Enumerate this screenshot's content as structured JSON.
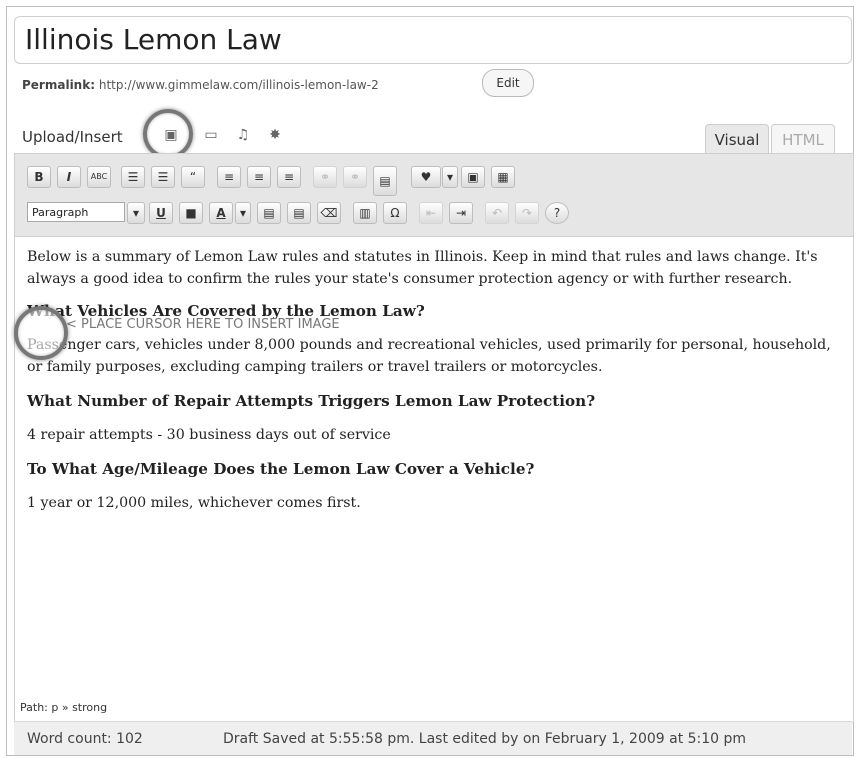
{
  "post": {
    "title": "Illinois Lemon Law",
    "permalink_label": "Permalink:",
    "permalink_url": "http://www.gimmelaw.com/illinois-lemon-law-2",
    "edit_label": "Edit"
  },
  "media": {
    "upload_label": "Upload/Insert",
    "icons": [
      "image-icon",
      "video-icon",
      "audio-icon",
      "media-icon"
    ]
  },
  "tabs": {
    "visual": "Visual",
    "html": "HTML"
  },
  "toolbar": {
    "row1": [
      "B",
      "I",
      "ABC",
      "☰",
      "☰",
      "“",
      "≡",
      "≡",
      "≡",
      "⚭",
      "⚭",
      "▤",
      "♥",
      "▾",
      "▣",
      "▦"
    ],
    "format_value": "Paragraph",
    "row2": [
      "U",
      "■",
      "A",
      "▾",
      "▤",
      "▤",
      "⌫",
      "▥",
      "Ω",
      "⇤",
      "⇥",
      "↶",
      "↷",
      "?"
    ]
  },
  "content": {
    "intro": "Below is a summary of Lemon Law rules and statutes in Illinois. Keep in mind that rules and laws change. It's always a good idea to confirm the rules your state's consumer protection agency or with further research.",
    "cursor_hint": "< PLACE CURSOR HERE TO INSERT IMAGE",
    "h1": "What Vehicles Are Covered by the Lemon Law?",
    "p1": "Passenger cars, vehicles under 8,000 pounds and recreational vehicles, used primarily for personal, household, or family purposes, excluding camping trailers or travel trailers or motorcycles.",
    "h2": "What Number of Repair Attempts Triggers Lemon Law Protection?",
    "p2": "4 repair attempts - 30 business days out of service",
    "h3": "To What Age/Mileage Does the Lemon Law Cover a Vehicle?",
    "p3": "1 year or 12,000 miles, whichever comes first."
  },
  "status": {
    "path": "Path: p » strong",
    "word_count": "Word count: 102",
    "draft": "Draft Saved at 5:55:58 pm. Last edited by on February 1, 2009 at 5:10 pm"
  }
}
